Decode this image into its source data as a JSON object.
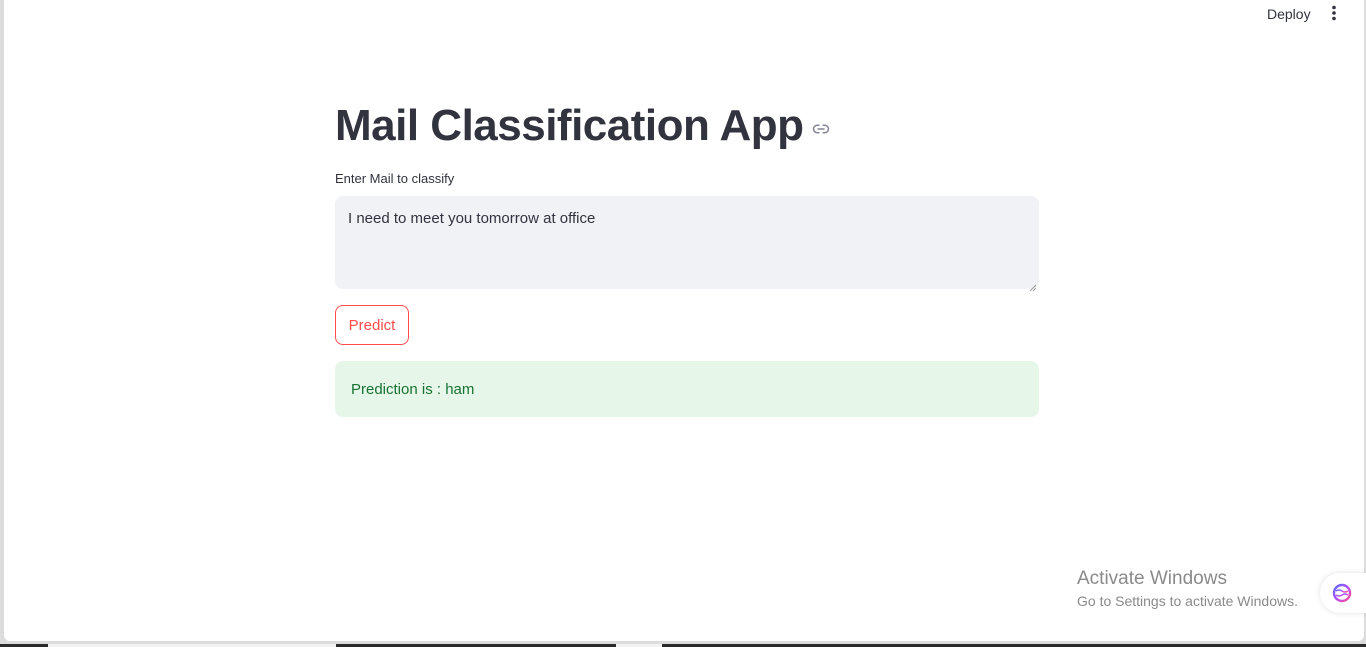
{
  "header": {
    "deploy_label": "Deploy",
    "menu_icon": "kebab-menu-icon"
  },
  "main": {
    "title": "Mail Classification App",
    "title_anchor_icon": "link-icon",
    "input_label": "Enter Mail to classify",
    "input_value": "I need to meet you tomorrow at office",
    "predict_label": "Predict",
    "result_text": "Prediction is : ham"
  },
  "watermark": {
    "line1": "Activate Windows",
    "line2": "Go to Settings to activate Windows."
  },
  "extension": {
    "icon": "brain-extension-icon"
  },
  "colors": {
    "accent": "#ff4b4b",
    "text": "#31333f",
    "input_bg": "#f0f2f6",
    "success_bg": "#e6f7ea",
    "success_text": "#177233"
  }
}
